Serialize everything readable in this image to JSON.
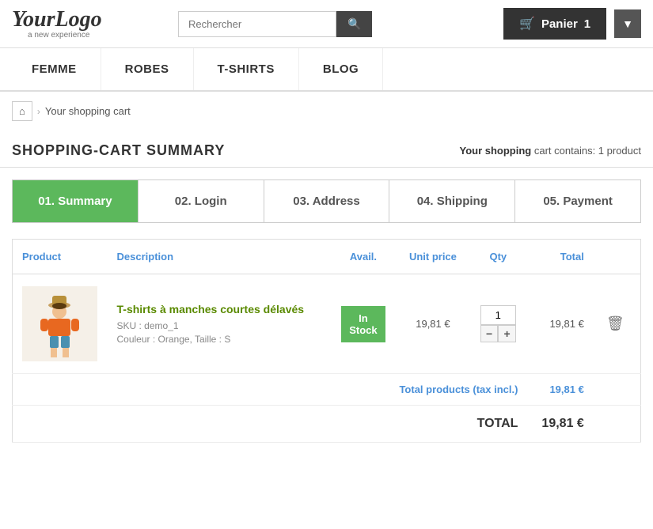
{
  "logo": {
    "main": "YourLogo",
    "sub": "a new experience"
  },
  "search": {
    "placeholder": "Rechercher"
  },
  "cart": {
    "label": "Panier",
    "count": "1"
  },
  "nav": {
    "items": [
      {
        "label": "FEMME"
      },
      {
        "label": "ROBES"
      },
      {
        "label": "T-SHIRTS"
      },
      {
        "label": "BLOG"
      }
    ]
  },
  "breadcrumb": {
    "home_icon": "⌂",
    "separator": "›",
    "current": "Your shopping cart"
  },
  "page": {
    "title": "SHOPPING-CART SUMMARY",
    "cart_info": "Your shopping cart contains: 1 product"
  },
  "steps": [
    {
      "label": "01. Summary",
      "active": true
    },
    {
      "label": "02. Login",
      "active": false
    },
    {
      "label": "03. Address",
      "active": false
    },
    {
      "label": "04. Shipping",
      "active": false
    },
    {
      "label": "05. Payment",
      "active": false
    }
  ],
  "table": {
    "headers": {
      "product": "Product",
      "description": "Description",
      "avail": "Avail.",
      "unit_price": "Unit price",
      "qty": "Qty",
      "total": "Total"
    },
    "rows": [
      {
        "sku": "SKU : demo_1",
        "color": "Couleur : Orange, Taille : S",
        "product_name": "T-shirts à manches courtes délavés",
        "stock": "In\nStock",
        "unit_price": "19,81 €",
        "qty": "1",
        "total_price": "19,81 €"
      }
    ],
    "subtotal_label": "Total products (tax incl.)",
    "subtotal_value": "19,81 €",
    "total_label": "TOTAL",
    "total_value": "19,81 €"
  }
}
